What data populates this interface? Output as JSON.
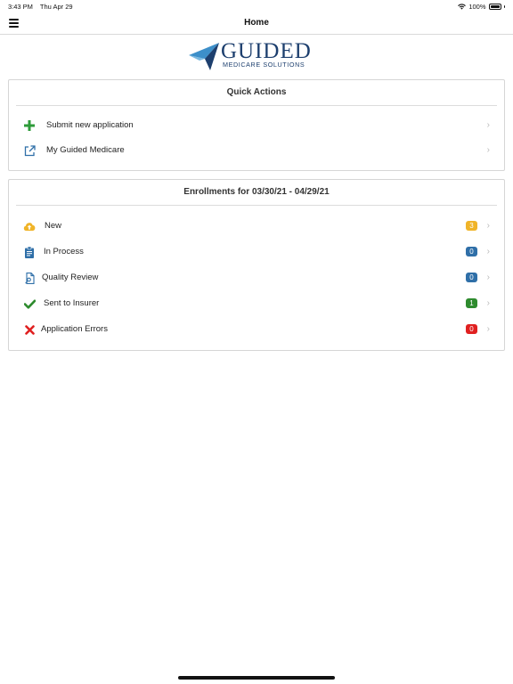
{
  "status_bar": {
    "time": "3:43 PM",
    "date": "Thu Apr 29",
    "battery": "100%"
  },
  "nav": {
    "title": "Home"
  },
  "logo": {
    "word": "GUIDED",
    "subtitle": "MEDICARE SOLUTIONS"
  },
  "quick_actions": {
    "title": "Quick Actions",
    "items": [
      {
        "label": "Submit new application",
        "icon": "plus-icon",
        "color": "#2e9b3a"
      },
      {
        "label": "My Guided Medicare",
        "icon": "external-link-icon",
        "color": "#2f6fa8"
      }
    ]
  },
  "enrollments": {
    "title": "Enrollments for 03/30/21 - 04/29/21",
    "items": [
      {
        "label": "New",
        "icon": "cloud-upload-icon",
        "count": "3",
        "color": "#f0b429"
      },
      {
        "label": "In Process",
        "icon": "clipboard-icon",
        "count": "0",
        "color": "#2f6fa8"
      },
      {
        "label": "Quality Review",
        "icon": "document-search-icon",
        "count": "0",
        "color": "#2f6fa8"
      },
      {
        "label": "Sent to Insurer",
        "icon": "checkmark-icon",
        "count": "1",
        "color": "#2e8b2e"
      },
      {
        "label": "Application Errors",
        "icon": "x-icon",
        "count": "0",
        "color": "#e02020"
      }
    ]
  }
}
